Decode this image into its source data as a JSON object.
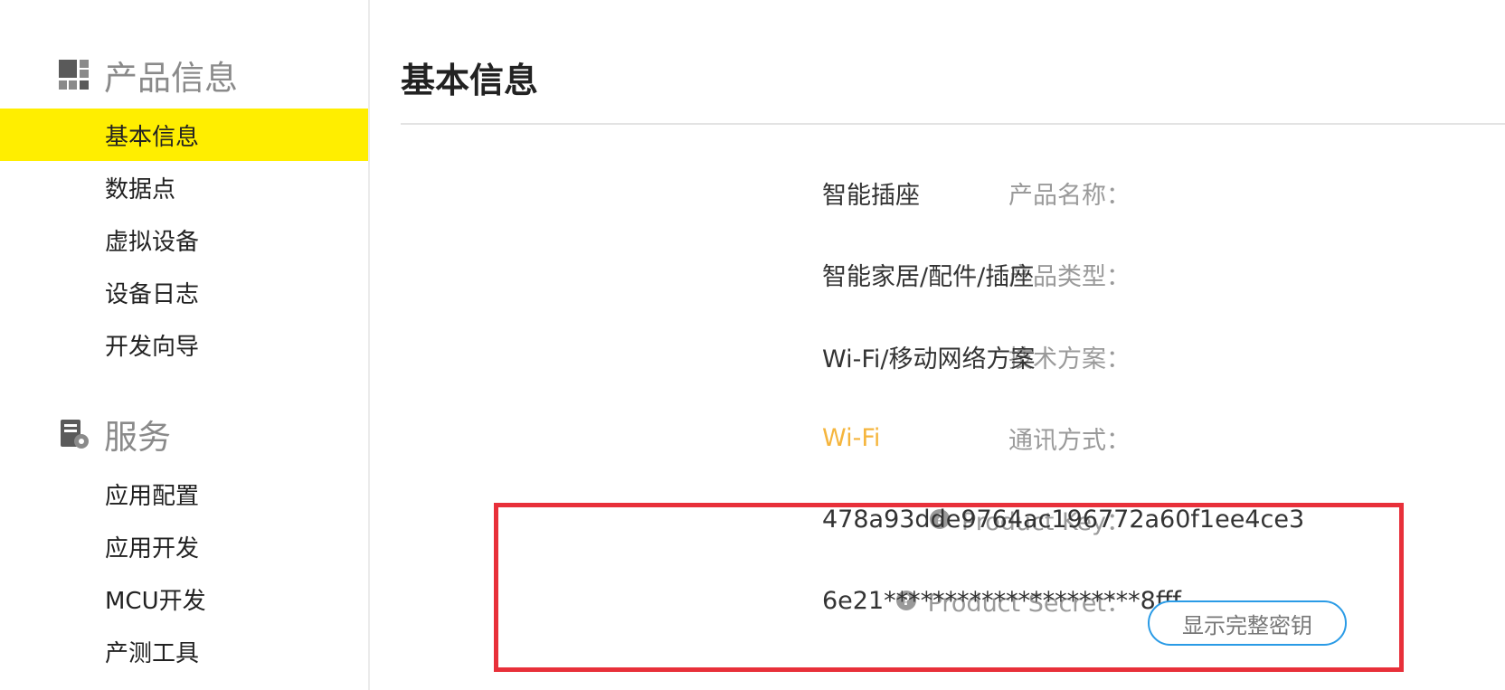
{
  "sidebar": {
    "groups": [
      {
        "title": "产品信息",
        "icon": "grid-icon",
        "items": [
          {
            "label": "基本信息",
            "active": true
          },
          {
            "label": "数据点"
          },
          {
            "label": "虚拟设备"
          },
          {
            "label": "设备日志"
          },
          {
            "label": "开发向导"
          }
        ]
      },
      {
        "title": "服务",
        "icon": "service-settings-icon",
        "items": [
          {
            "label": "应用配置"
          },
          {
            "label": "应用开发"
          },
          {
            "label": "MCU开发"
          },
          {
            "label": "产测工具"
          }
        ]
      }
    ]
  },
  "main": {
    "title": "基本信息",
    "fields": [
      {
        "label": "产品名称：",
        "value": "智能插座"
      },
      {
        "label": "产品类型：",
        "value": "智能家居/配件/插座"
      },
      {
        "label": "技术方案：",
        "value": "Wi-Fi/移动网络方案"
      },
      {
        "label": "通讯方式：",
        "value": "Wi-Fi"
      },
      {
        "label": "Product Key：",
        "value": "478a93dde9764ac196772a60f1ee4ce3",
        "icon": "question-circle-icon"
      },
      {
        "label": "Product Secret：",
        "value": "6e21*********************8fff",
        "icon": "question-circle-icon"
      }
    ],
    "reveal_button": "显示完整密钥"
  },
  "colors": {
    "active_nav": "#ffee00",
    "accent_value": "#f5b53d",
    "highlight_border": "#e8303a",
    "button_border": "#2a9be6"
  }
}
